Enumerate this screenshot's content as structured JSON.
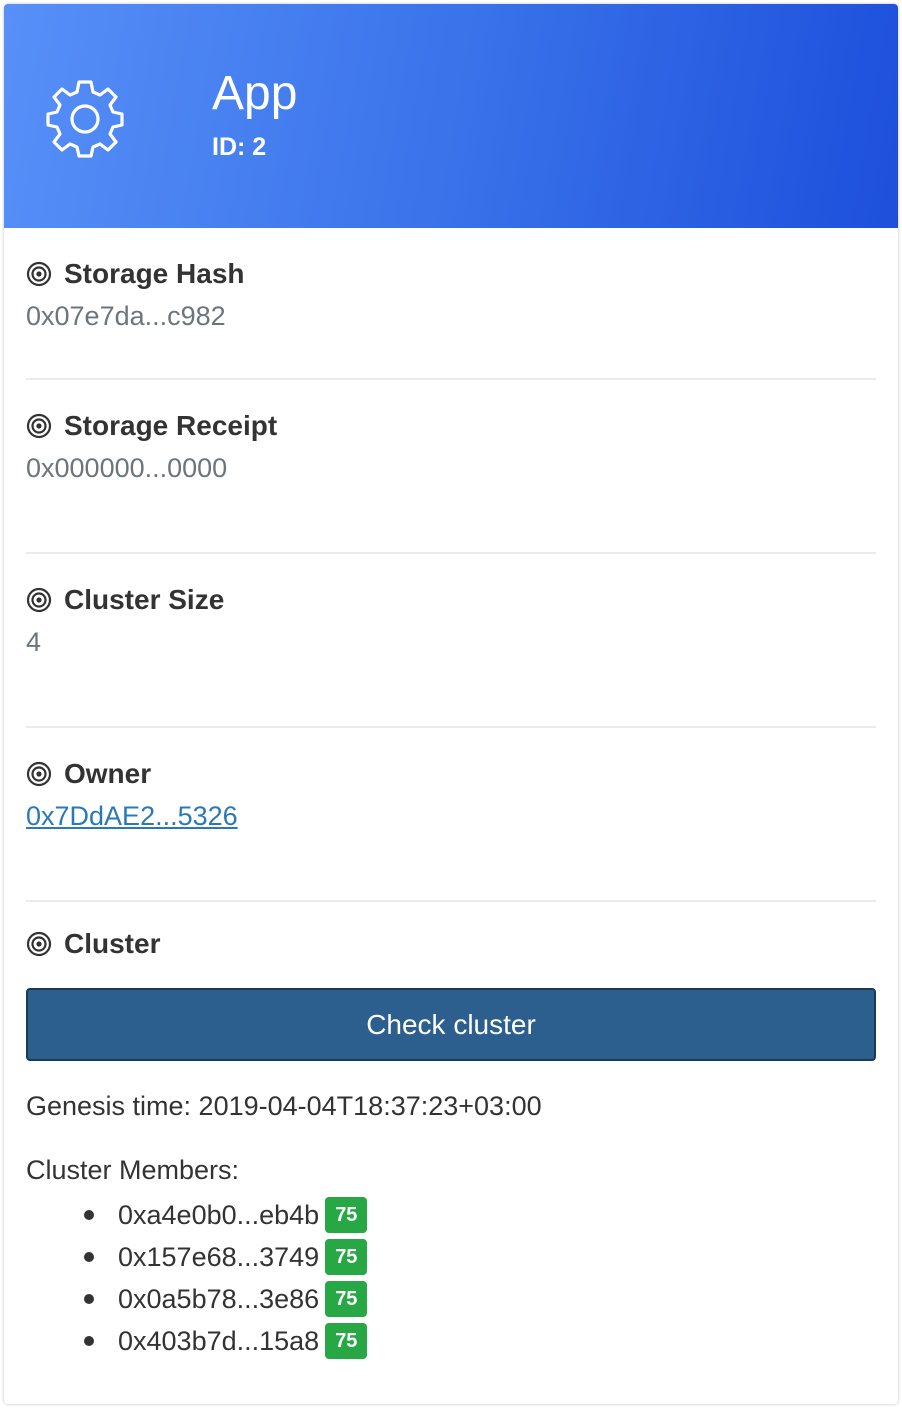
{
  "header": {
    "title": "App",
    "subtitle": "ID: 2",
    "icon": "gear-icon",
    "gradient": [
      "#5790f8",
      "#1d4fdc"
    ]
  },
  "fields": [
    {
      "label": "Storage Hash",
      "value": "0x07e7da...c982",
      "icon": "target-icon"
    },
    {
      "label": "Storage Receipt",
      "value": "0x000000...0000",
      "icon": "target-icon"
    },
    {
      "label": "Cluster Size",
      "value": "4",
      "icon": "target-icon"
    },
    {
      "label": "Owner",
      "value": "0x7DdAE2...5326",
      "icon": "target-icon",
      "is_link": true
    }
  ],
  "cluster": {
    "label": "Cluster",
    "icon": "target-icon",
    "button_label": "Check cluster",
    "genesis": "Genesis time: 2019-04-04T18:37:23+03:00",
    "members_label": "Cluster Members:",
    "members": [
      {
        "address": "0xa4e0b0...eb4b",
        "badge": "75"
      },
      {
        "address": "0x157e68...3749",
        "badge": "75"
      },
      {
        "address": "0x0a5b78...3e86",
        "badge": "75"
      },
      {
        "address": "0x403b7d...15a8",
        "badge": "75"
      }
    ]
  },
  "colors": {
    "button": "#2c5f8d",
    "badge": "#28a745",
    "link": "#2a78b7"
  }
}
